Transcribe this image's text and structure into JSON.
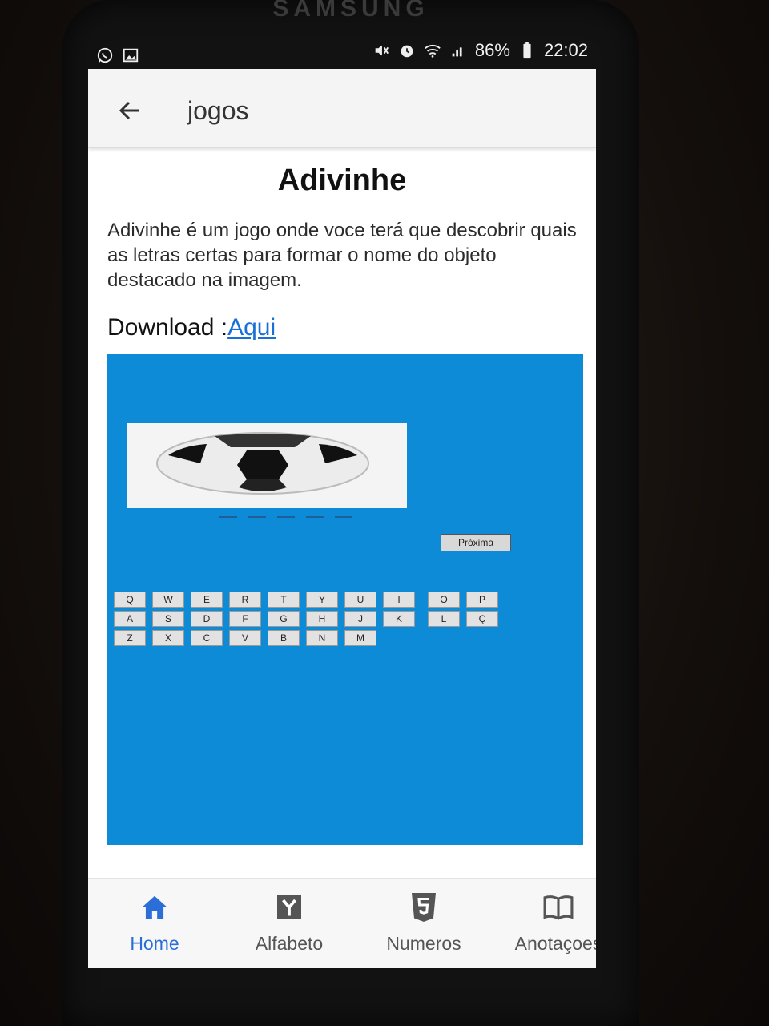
{
  "device": {
    "brand": "SAMSUNG"
  },
  "status_bar": {
    "battery": "86%",
    "time": "22:02",
    "notification_icons": [
      "whatsapp-icon",
      "image-icon"
    ],
    "system_icons": [
      "mute-icon",
      "alarm-icon",
      "wifi-icon",
      "signal-icon",
      "battery-icon"
    ]
  },
  "appbar": {
    "title": "jogos",
    "back_icon": "arrow-left-icon"
  },
  "page": {
    "title": "Adivinhe",
    "description": "Adivinhe é um jogo onde voce terá que descobrir quais as letras certas para formar o nome do objeto destacado na imagem.",
    "download_label": "Download :",
    "download_link": "Aqui"
  },
  "game": {
    "background": "#0d8bd6",
    "image_subject": "soccer-ball",
    "next_button": "Próxima",
    "keyboard_rows": [
      [
        "Q",
        "W",
        "E",
        "R",
        "T",
        "Y",
        "U",
        "I",
        "O",
        "P"
      ],
      [
        "A",
        "S",
        "D",
        "F",
        "G",
        "H",
        "J",
        "K",
        "L",
        "Ç"
      ],
      [
        "Z",
        "X",
        "C",
        "V",
        "B",
        "N",
        "M"
      ]
    ]
  },
  "bottom_nav": [
    {
      "label": "Home",
      "icon": "home-icon",
      "active": true
    },
    {
      "label": "Alfabeto",
      "icon": "letter-y-icon",
      "active": false
    },
    {
      "label": "Numeros",
      "icon": "html5-icon",
      "active": false
    },
    {
      "label": "Anotaçoes",
      "icon": "book-icon",
      "active": false
    }
  ],
  "colors": {
    "accent": "#2b6ed8",
    "link": "#1a6fd6",
    "game_bg": "#0d8bd6"
  }
}
